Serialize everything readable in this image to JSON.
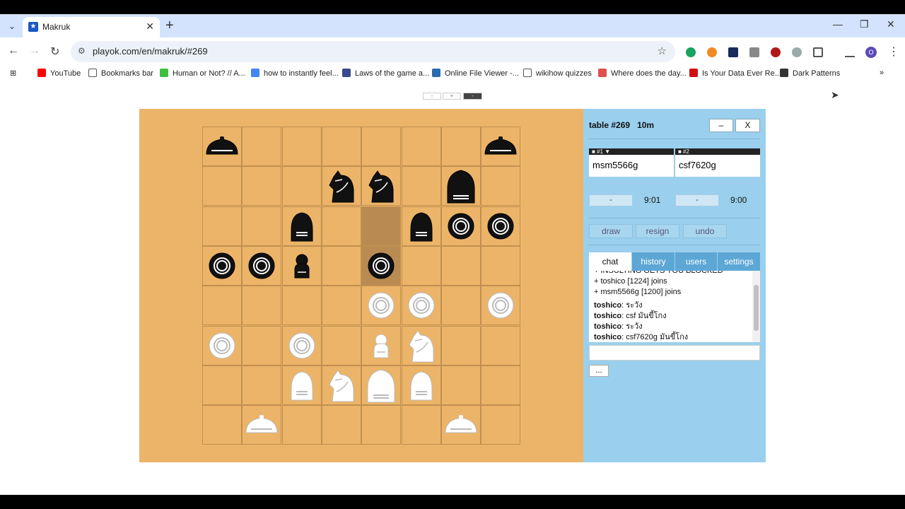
{
  "browser": {
    "tab_title": "Makruk",
    "tab_favicon": "★",
    "url": "playok.com/en/makruk/#269",
    "bookmarks": [
      {
        "label": "YouTube",
        "color": "#ff0000"
      },
      {
        "label": "Bookmarks bar",
        "color": "#ffffff"
      },
      {
        "label": "Human or Not? // A...",
        "color": "#3fbf3f"
      },
      {
        "label": "how to instantly feel...",
        "color": "#4285f4"
      },
      {
        "label": "Laws of the game a...",
        "color": "#3a4a8a"
      },
      {
        "label": "Online File Viewer -...",
        "color": "#2b6cb0"
      },
      {
        "label": "wikihow quizzes",
        "color": "#ffffff"
      },
      {
        "label": "Where does the day...",
        "color": "#e05050"
      },
      {
        "label": "Is Your Data Ever Re...",
        "color": "#d01010"
      },
      {
        "label": "Dark Patterns",
        "color": "#333333"
      }
    ],
    "more_bookmarks": "»",
    "profile_initial": "O"
  },
  "zoom_controls": [
    "-",
    "+",
    "-"
  ],
  "game": {
    "table_label": "table #269",
    "time_control": "10m",
    "minimize_label": "–",
    "close_label": "X",
    "players": [
      {
        "seat": "■ #1 ▼",
        "name": "msm5566g",
        "button": "-",
        "clock": "9:01"
      },
      {
        "seat": "■ #2",
        "name": "csf7620g",
        "button": "-",
        "clock": "9:00"
      }
    ],
    "actions": {
      "draw": "draw",
      "resign": "resign",
      "undo": "undo"
    },
    "tabs": [
      "chat",
      "history",
      "users",
      "settings"
    ],
    "chat": [
      {
        "user": "",
        "text": "+ INSULTING GETS YOU BLOCKED"
      },
      {
        "user": "",
        "text": "+ toshico [1224] joins"
      },
      {
        "user": "",
        "text": "+ msm5566g [1200] joins"
      },
      {
        "user": "toshico",
        "text": ": ระวัง"
      },
      {
        "user": "toshico",
        "text": ": csf มันขี้โกง"
      },
      {
        "user": "toshico",
        "text": ": ระวัง"
      },
      {
        "user": "toshico",
        "text": ": csf7620g มันขี้โกง"
      }
    ],
    "more_label": "...",
    "highlight_squares": [
      [
        2,
        4
      ],
      [
        3,
        4
      ]
    ],
    "pieces": [
      {
        "row": 0,
        "col": 0,
        "type": "rook",
        "color": "black"
      },
      {
        "row": 0,
        "col": 7,
        "type": "rook",
        "color": "black"
      },
      {
        "row": 1,
        "col": 3,
        "type": "knight",
        "color": "black"
      },
      {
        "row": 1,
        "col": 4,
        "type": "knight",
        "color": "black"
      },
      {
        "row": 1,
        "col": 6,
        "type": "king",
        "color": "black"
      },
      {
        "row": 2,
        "col": 2,
        "type": "bishop",
        "color": "black"
      },
      {
        "row": 2,
        "col": 5,
        "type": "bishop",
        "color": "black"
      },
      {
        "row": 2,
        "col": 6,
        "type": "pawn",
        "color": "black"
      },
      {
        "row": 2,
        "col": 7,
        "type": "pawn",
        "color": "black"
      },
      {
        "row": 3,
        "col": 0,
        "type": "pawn",
        "color": "black"
      },
      {
        "row": 3,
        "col": 1,
        "type": "pawn",
        "color": "black"
      },
      {
        "row": 3,
        "col": 2,
        "type": "queen",
        "color": "black"
      },
      {
        "row": 3,
        "col": 4,
        "type": "pawn",
        "color": "black"
      },
      {
        "row": 4,
        "col": 4,
        "type": "pawn",
        "color": "white"
      },
      {
        "row": 4,
        "col": 5,
        "type": "pawn",
        "color": "white"
      },
      {
        "row": 4,
        "col": 7,
        "type": "pawn",
        "color": "white"
      },
      {
        "row": 5,
        "col": 0,
        "type": "pawn",
        "color": "white"
      },
      {
        "row": 5,
        "col": 2,
        "type": "pawn",
        "color": "white"
      },
      {
        "row": 5,
        "col": 4,
        "type": "queen",
        "color": "white"
      },
      {
        "row": 5,
        "col": 5,
        "type": "knight",
        "color": "white"
      },
      {
        "row": 6,
        "col": 2,
        "type": "bishop",
        "color": "white"
      },
      {
        "row": 6,
        "col": 3,
        "type": "knight",
        "color": "white"
      },
      {
        "row": 6,
        "col": 4,
        "type": "king",
        "color": "white"
      },
      {
        "row": 6,
        "col": 5,
        "type": "bishop",
        "color": "white"
      },
      {
        "row": 7,
        "col": 1,
        "type": "rook",
        "color": "white"
      },
      {
        "row": 7,
        "col": 6,
        "type": "rook",
        "color": "white"
      }
    ]
  }
}
